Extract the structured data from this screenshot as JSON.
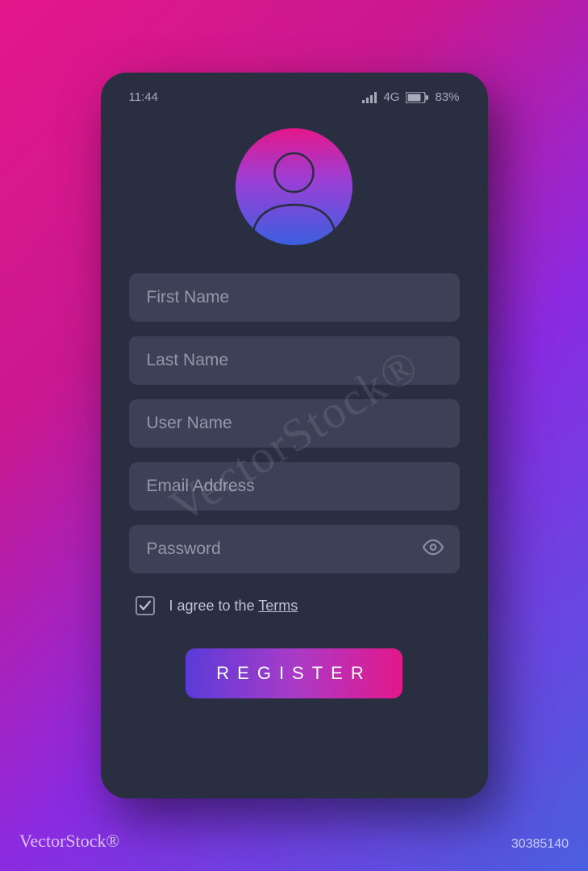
{
  "status_bar": {
    "time": "11:44",
    "network": "4G",
    "battery": "83%"
  },
  "form": {
    "fields": {
      "first_name": {
        "placeholder": "First Name",
        "value": ""
      },
      "last_name": {
        "placeholder": "Last Name",
        "value": ""
      },
      "user_name": {
        "placeholder": "User Name",
        "value": ""
      },
      "email": {
        "placeholder": "Email Address",
        "value": ""
      },
      "password": {
        "placeholder": "Password",
        "value": ""
      }
    },
    "terms": {
      "checked": true,
      "text_prefix": "I agree to the ",
      "link_text": "Terms"
    },
    "submit_label": "REGISTER"
  },
  "watermark": {
    "brand": "VectorStock®",
    "id": "30385140",
    "diag": "VectorStock®"
  },
  "colors": {
    "bg_dark": "#2a2e41",
    "input_bg": "#3d4157",
    "gradient_start": "#e4178b",
    "gradient_end": "#4a5fdf"
  }
}
